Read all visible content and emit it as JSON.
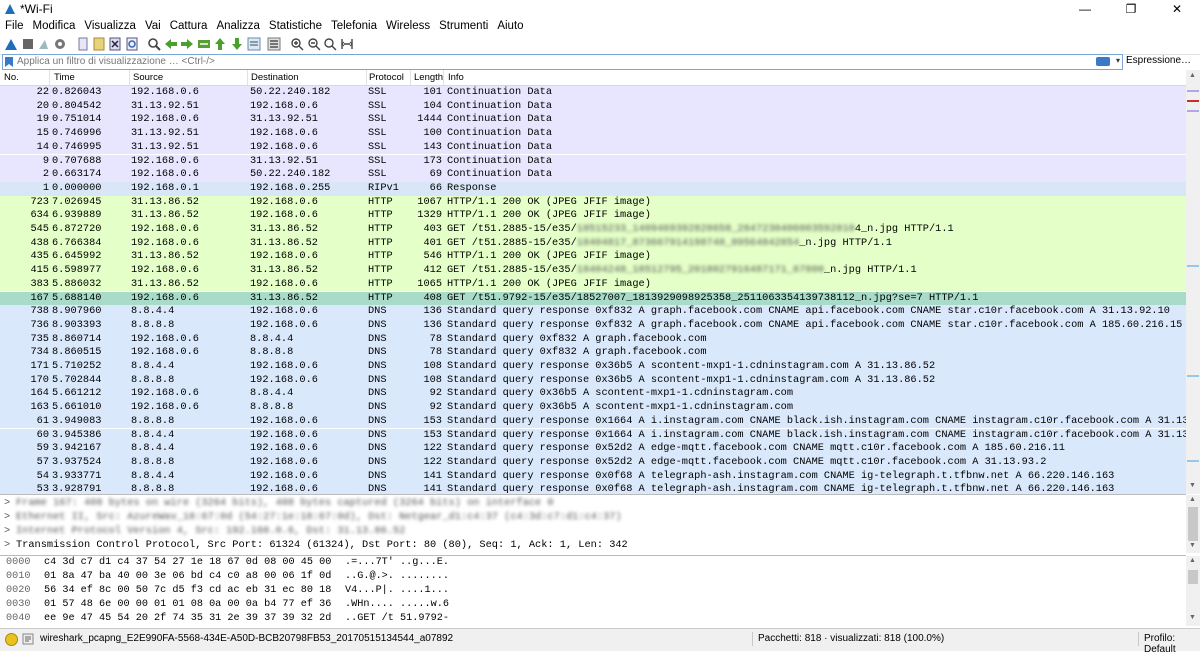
{
  "window": {
    "title": "*Wi-Fi"
  },
  "menu": [
    "File",
    "Modifica",
    "Visualizza",
    "Vai",
    "Cattura",
    "Analizza",
    "Statistiche",
    "Telefonia",
    "Wireless",
    "Strumenti",
    "Aiuto"
  ],
  "filter": {
    "placeholder": "Applica un filtro di visualizzazione … <Ctrl-/>",
    "expression_label": "Espressione…"
  },
  "columns": {
    "no": "No.",
    "time": "Time",
    "source": "Source",
    "destination": "Destination",
    "protocol": "Protocol",
    "length": "Length",
    "info": "Info"
  },
  "colors": {
    "ssl": "#e7e6fe",
    "rip": "#d9e6f8",
    "http": "#e4ffc7",
    "dns": "#dae8fb",
    "selected": "#a8dcc8"
  },
  "packets": [
    {
      "no": "22",
      "time": "0.826043",
      "src": "192.168.0.6",
      "dst": "50.22.240.182",
      "proto": "SSL",
      "len": "101",
      "info": "Continuation Data",
      "color": "ssl"
    },
    {
      "no": "20",
      "time": "0.804542",
      "src": "31.13.92.51",
      "dst": "192.168.0.6",
      "proto": "SSL",
      "len": "104",
      "info": "Continuation Data",
      "color": "ssl"
    },
    {
      "no": "19",
      "time": "0.751014",
      "src": "192.168.0.6",
      "dst": "31.13.92.51",
      "proto": "SSL",
      "len": "1444",
      "info": "Continuation Data",
      "color": "ssl"
    },
    {
      "no": "15",
      "time": "0.746996",
      "src": "31.13.92.51",
      "dst": "192.168.0.6",
      "proto": "SSL",
      "len": "100",
      "info": "Continuation Data",
      "color": "ssl"
    },
    {
      "no": "14",
      "time": "0.746995",
      "src": "31.13.92.51",
      "dst": "192.168.0.6",
      "proto": "SSL",
      "len": "143",
      "info": "Continuation Data",
      "color": "ssl"
    },
    {
      "no": "9",
      "time": "0.707688",
      "src": "192.168.0.6",
      "dst": "31.13.92.51",
      "proto": "SSL",
      "len": "173",
      "info": "Continuation Data",
      "color": "ssl"
    },
    {
      "no": "2",
      "time": "0.663174",
      "src": "192.168.0.6",
      "dst": "50.22.240.182",
      "proto": "SSL",
      "len": "69",
      "info": "Continuation Data",
      "color": "ssl"
    },
    {
      "no": "1",
      "time": "0.000000",
      "src": "192.168.0.1",
      "dst": "192.168.0.255",
      "proto": "RIPv1",
      "len": "66",
      "info": "Response",
      "color": "rip"
    },
    {
      "no": "723",
      "time": "7.026945",
      "src": "31.13.86.52",
      "dst": "192.168.0.6",
      "proto": "HTTP",
      "len": "1067",
      "info": "HTTP/1.1 200 OK  (JPEG JFIF image)",
      "color": "http"
    },
    {
      "no": "634",
      "time": "6.939889",
      "src": "31.13.86.52",
      "dst": "192.168.0.6",
      "proto": "HTTP",
      "len": "1329",
      "info": "HTTP/1.1 200 OK  (JPEG JFIF image)",
      "color": "http"
    },
    {
      "no": "545",
      "time": "6.872720",
      "src": "192.168.0.6",
      "dst": "31.13.86.52",
      "proto": "HTTP",
      "len": "403",
      "info": "GET /t51.2885-15/e35/",
      "info_blur": "18515233_1409469392828658_2847230406003592810",
      "info_tail": "4_n.jpg HTTP/1.1",
      "color": "http"
    },
    {
      "no": "438",
      "time": "6.766384",
      "src": "192.168.0.6",
      "dst": "31.13.86.52",
      "proto": "HTTP",
      "len": "401",
      "info": "GET /t51.2885-15/e35/",
      "info_blur": "18404817_873667914198748_89564842854",
      "info_tail": "_n.jpg HTTP/1.1",
      "color": "http"
    },
    {
      "no": "435",
      "time": "6.645992",
      "src": "31.13.86.52",
      "dst": "192.168.0.6",
      "proto": "HTTP",
      "len": "546",
      "info": "HTTP/1.1 200 OK  (JPEG JFIF image)",
      "color": "http"
    },
    {
      "no": "415",
      "time": "6.598977",
      "src": "192.168.0.6",
      "dst": "31.13.86.52",
      "proto": "HTTP",
      "len": "412",
      "info": "GET /t51.2885-15/e35/",
      "info_blur": "18404248_18512795_2018027916487171_67800",
      "info_tail": "_n.jpg HTTP/1.1",
      "color": "http"
    },
    {
      "no": "383",
      "time": "5.886032",
      "src": "31.13.86.52",
      "dst": "192.168.0.6",
      "proto": "HTTP",
      "len": "1065",
      "info": "HTTP/1.1 200 OK  (JPEG JFIF image)",
      "color": "http"
    },
    {
      "no": "167",
      "time": "5.688140",
      "src": "192.168.0.6",
      "dst": "31.13.86.52",
      "proto": "HTTP",
      "len": "408",
      "info": "GET /t51.9792-15/e35/18527007_1813929098925358_2511063354139738112_n.jpg?se=7 HTTP/1.1",
      "color": "selected"
    },
    {
      "no": "738",
      "time": "8.907960",
      "src": "8.8.4.4",
      "dst": "192.168.0.6",
      "proto": "DNS",
      "len": "136",
      "info": "Standard query response 0xf832 A graph.facebook.com CNAME api.facebook.com CNAME star.c10r.facebook.com A 31.13.92.10",
      "color": "dns"
    },
    {
      "no": "736",
      "time": "8.903393",
      "src": "8.8.8.8",
      "dst": "192.168.0.6",
      "proto": "DNS",
      "len": "136",
      "info": "Standard query response 0xf832 A graph.facebook.com CNAME api.facebook.com CNAME star.c10r.facebook.com A 185.60.216.15",
      "color": "dns"
    },
    {
      "no": "735",
      "time": "8.860714",
      "src": "192.168.0.6",
      "dst": "8.8.4.4",
      "proto": "DNS",
      "len": "78",
      "info": "Standard query 0xf832 A graph.facebook.com",
      "color": "dns"
    },
    {
      "no": "734",
      "time": "8.860515",
      "src": "192.168.0.6",
      "dst": "8.8.8.8",
      "proto": "DNS",
      "len": "78",
      "info": "Standard query 0xf832 A graph.facebook.com",
      "color": "dns"
    },
    {
      "no": "171",
      "time": "5.710252",
      "src": "8.8.4.4",
      "dst": "192.168.0.6",
      "proto": "DNS",
      "len": "108",
      "info": "Standard query response 0x36b5 A scontent-mxp1-1.cdninstagram.com A 31.13.86.52",
      "color": "dns"
    },
    {
      "no": "170",
      "time": "5.702844",
      "src": "8.8.8.8",
      "dst": "192.168.0.6",
      "proto": "DNS",
      "len": "108",
      "info": "Standard query response 0x36b5 A scontent-mxp1-1.cdninstagram.com A 31.13.86.52",
      "color": "dns"
    },
    {
      "no": "164",
      "time": "5.661212",
      "src": "192.168.0.6",
      "dst": "8.8.4.4",
      "proto": "DNS",
      "len": "92",
      "info": "Standard query 0x36b5 A scontent-mxp1-1.cdninstagram.com",
      "color": "dns"
    },
    {
      "no": "163",
      "time": "5.661010",
      "src": "192.168.0.6",
      "dst": "8.8.8.8",
      "proto": "DNS",
      "len": "92",
      "info": "Standard query 0x36b5 A scontent-mxp1-1.cdninstagram.com",
      "color": "dns"
    },
    {
      "no": "61",
      "time": "3.949083",
      "src": "8.8.8.8",
      "dst": "192.168.0.6",
      "proto": "DNS",
      "len": "153",
      "info": "Standard query response 0x1664 A i.instagram.com CNAME black.ish.instagram.com CNAME instagram.c10r.facebook.com A 31.13.92.51",
      "color": "dns"
    },
    {
      "no": "60",
      "time": "3.945386",
      "src": "8.8.4.4",
      "dst": "192.168.0.6",
      "proto": "DNS",
      "len": "153",
      "info": "Standard query response 0x1664 A i.instagram.com CNAME black.ish.instagram.com CNAME instagram.c10r.facebook.com A 31.13.92.51",
      "color": "dns"
    },
    {
      "no": "59",
      "time": "3.942167",
      "src": "8.8.4.4",
      "dst": "192.168.0.6",
      "proto": "DNS",
      "len": "122",
      "info": "Standard query response 0x52d2 A edge-mqtt.facebook.com CNAME mqtt.c10r.facebook.com A 185.60.216.11",
      "color": "dns"
    },
    {
      "no": "57",
      "time": "3.937524",
      "src": "8.8.8.8",
      "dst": "192.168.0.6",
      "proto": "DNS",
      "len": "122",
      "info": "Standard query response 0x52d2 A edge-mqtt.facebook.com CNAME mqtt.c10r.facebook.com A 31.13.93.2",
      "color": "dns"
    },
    {
      "no": "54",
      "time": "3.933771",
      "src": "8.8.4.4",
      "dst": "192.168.0.6",
      "proto": "DNS",
      "len": "141",
      "info": "Standard query response 0x0f68 A telegraph-ash.instagram.com CNAME ig-telegraph.t.tfbnw.net A 66.220.146.163",
      "color": "dns"
    },
    {
      "no": "53",
      "time": "3.928791",
      "src": "8.8.8.8",
      "dst": "192.168.0.6",
      "proto": "DNS",
      "len": "141",
      "info": "Standard query response 0x0f68 A telegraph-ash.instagram.com CNAME ig-telegraph.t.tfbnw.net A 66.220.146.163",
      "color": "dns"
    }
  ],
  "details": [
    {
      "text": "Frame 167: 408 bytes on wire (3264 bits), 408 bytes captured (3264 bits) on interface 0",
      "blurred": true
    },
    {
      "text": "Ethernet II, Src: AzureWav_18:67:0d (54:27:1e:18:67:0d), Dst: Netgear_d1:c4:37 (c4:3d:c7:d1:c4:37)",
      "blurred": true
    },
    {
      "text": "Internet Protocol Version 4, Src: 192.168.0.6, Dst: 31.13.86.52",
      "blurred": true
    },
    {
      "text": "Transmission Control Protocol, Src Port: 61324 (61324), Dst Port: 80 (80), Seq: 1, Ack: 1, Len: 342",
      "blurred": false
    }
  ],
  "bytes": [
    {
      "off": "0000",
      "hex": "c4 3d c7 d1 c4 37 54 27  1e 18 67 0d 08 00 45 00",
      "asc": ".=...7T' ..g...E."
    },
    {
      "off": "0010",
      "hex": "01 8a 47 ba 40 00 3e 06  bd c4 c0 a8 00 06 1f 0d",
      "asc": "..G.@.>. ........"
    },
    {
      "off": "0020",
      "hex": "56 34 ef 8c 00 50 7c d5  f3 cd ac eb 31 ec 80 18",
      "asc": "V4...P|. ....1..."
    },
    {
      "off": "0030",
      "hex": "01 57 48 6e 00 00 01 01  08 0a 00 0a b4 77 ef 36",
      "asc": ".WHn.... .....w.6"
    },
    {
      "off": "0040",
      "hex": "ee 9e 47 45 54 20 2f 74  35 31 2e 39 37 39 32 2d",
      "asc": "..GET /t 51.9792-"
    }
  ],
  "status": {
    "file": "wireshark_pcapng_E2E990FA-5568-434E-A50D-BCB20798FB53_20170515134544_a07892",
    "packets": "Pacchetti: 818 · visualizzati: 818 (100.0%)",
    "profile": "Profilo: Default"
  }
}
